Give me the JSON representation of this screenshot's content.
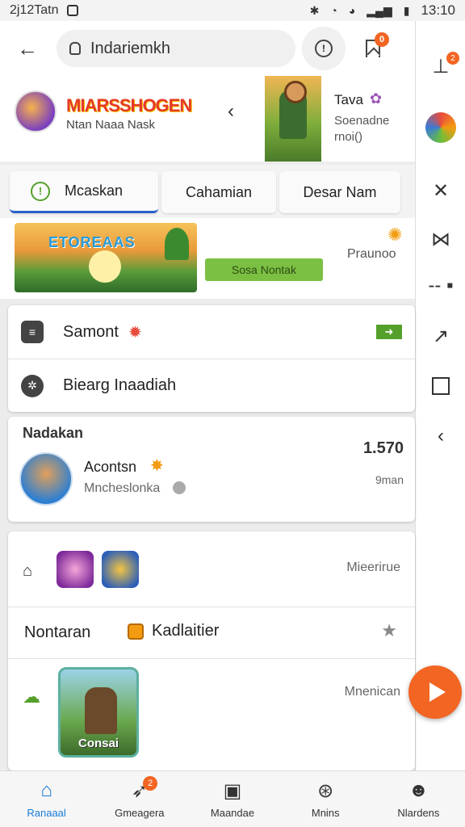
{
  "status_bar": {
    "time_left": "2j12Tatn",
    "time_right": "13:10",
    "icons": [
      "notification-icon",
      "bluetooth-icon",
      "wifi-icon",
      "wifi-icon",
      "signal-icon",
      "battery-icon"
    ]
  },
  "top_bar": {
    "search_text": "Indariemkh",
    "bookmark_badge": "0"
  },
  "side_rail": {
    "top_badge": "2",
    "icons": [
      "antenna-icon",
      "avatar",
      "tools-icon",
      "crown-icon",
      "dash-icon",
      "arrow-up-right-icon",
      "square-icon",
      "back-chevron-icon"
    ]
  },
  "promo": {
    "title": "MIARSSHOGEN",
    "subtitle": "Ntan Naaa Nask",
    "side_name": "Tava",
    "side_desc": "Soenadne rnoi()"
  },
  "tabs": [
    {
      "label": "Mcaskan",
      "active": true
    },
    {
      "label": "Cahamian",
      "active": false
    },
    {
      "label": "Desar Nam",
      "active": false
    }
  ],
  "banner": {
    "image_text": "ETOREAAS",
    "cta": "Sosa Nontak",
    "side_label": "Praunoo"
  },
  "list": [
    {
      "label": "Samont",
      "icon": "menu-icon"
    },
    {
      "label": "Biearg Inaadiah",
      "icon": "settings-icon"
    }
  ],
  "detail": {
    "heading": "Nadakan",
    "title": "Acontsn",
    "subtitle": "Mncheslonka",
    "value": "1.570",
    "unit": "9man"
  },
  "bottom_card": {
    "row_a_label": "Mieerirue",
    "row_b_title": "Nontaran",
    "row_b_label": "Kadlaitier",
    "row_c_label": "Mnenican",
    "game_caption": "Consai"
  },
  "bottom_nav": [
    {
      "label": "Ranaaal",
      "icon": "home-icon",
      "active": true
    },
    {
      "label": "Gmeagera",
      "icon": "rocket-icon",
      "active": false,
      "badge": "2"
    },
    {
      "label": "Maandae",
      "icon": "calendar-icon",
      "active": false
    },
    {
      "label": "Mnins",
      "icon": "compass-icon",
      "active": false
    },
    {
      "label": "Nlardens",
      "icon": "person-icon",
      "active": false
    }
  ],
  "colors": {
    "accent_orange": "#f26522",
    "active_blue": "#1a7bd6",
    "tab_underline": "#2a62c9",
    "green": "#55a02b"
  }
}
